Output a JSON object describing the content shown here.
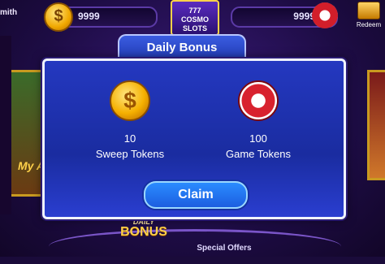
{
  "topbar": {
    "username": "mith",
    "coins": "9999",
    "tokens": "9999",
    "logo_line1": "777",
    "logo_line2": "COSMO",
    "logo_line3": "SLOTS",
    "redeem_label": "Redeem"
  },
  "dialog": {
    "title": "Daily Bonus",
    "rewards": [
      {
        "amount": "10",
        "label": "Sweep Tokens",
        "icon": "gold-coin-icon"
      },
      {
        "amount": "100",
        "label": "Game Tokens",
        "icon": "poker-chip-icon"
      }
    ],
    "claim_label": "Claim"
  },
  "background": {
    "left_game_text": "My\nAz",
    "bottom_bonus_small": "DAILY",
    "bottom_bonus_big": "BONUS",
    "bottom_offers": "Special Offers"
  },
  "colors": {
    "dialog_bg": "#1a2ca0",
    "claim_button": "#2a8cff",
    "coin": "#f5b000",
    "chip": "#d8222e"
  }
}
